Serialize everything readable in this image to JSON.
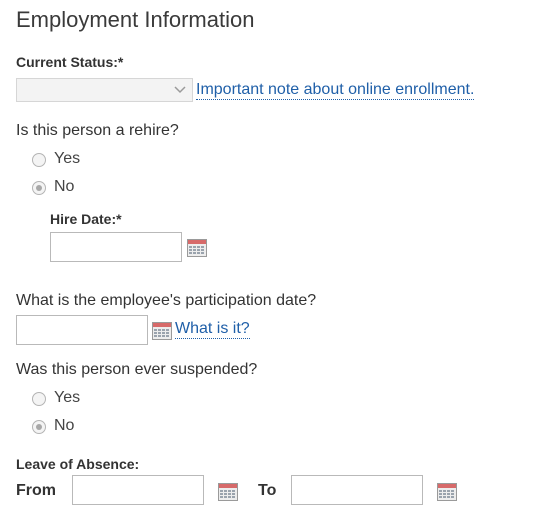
{
  "form": {
    "title": "Employment Information",
    "current_status": {
      "label": "Current Status:*",
      "selected_value": "",
      "note_link": "Important note about online enrollment."
    },
    "rehire": {
      "question": "Is this person a rehire?",
      "options": [
        "Yes",
        "No"
      ],
      "selected": "No"
    },
    "hire_date": {
      "label": "Hire Date:*",
      "value": ""
    },
    "participation": {
      "question": "What is the employee's participation date?",
      "value": "",
      "help_link": "What is it?"
    },
    "suspended": {
      "question": "Was this person ever suspended?",
      "options": [
        "Yes",
        "No"
      ],
      "selected": "No"
    },
    "leave_of_absence": {
      "label": "Leave of Absence:",
      "from_label": "From",
      "from_value": "",
      "to_label": "To",
      "to_value": ""
    }
  },
  "icons": {
    "calendar": "calendar-icon",
    "dropdown": "chevron-down-icon",
    "radio": "radio-button"
  },
  "colors": {
    "link": "#1f5fa8",
    "calendar_header": "#d76a6a",
    "radio_checked_dot": "#a8a8a8"
  }
}
